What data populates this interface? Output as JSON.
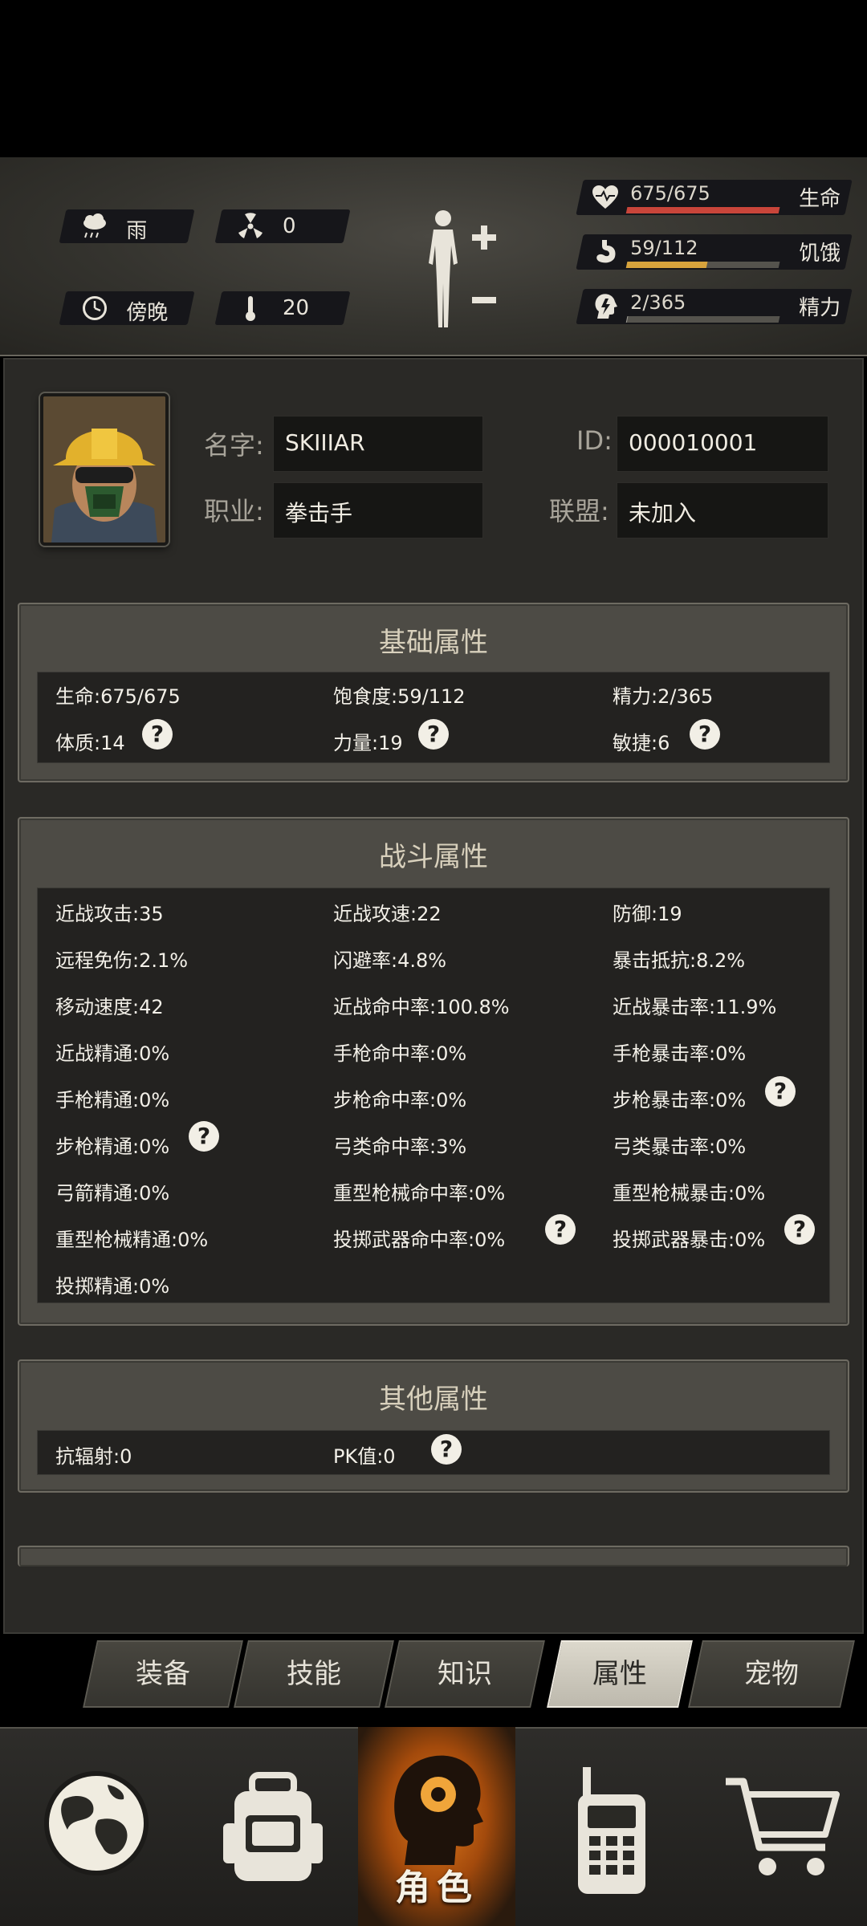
{
  "hud": {
    "weather": "雨",
    "radiation": "0",
    "time_of_day": "傍晚",
    "temperature": "20",
    "health": {
      "value": "675/675",
      "label": "生命",
      "fraction": 1.0,
      "color": "#c9453a"
    },
    "hunger": {
      "value": "59/112",
      "label": "饥饿",
      "fraction": 0.527,
      "color": "#d7a33c"
    },
    "energy": {
      "value": "2/365",
      "label": "精力",
      "fraction": 0.005,
      "color": "#9a9890"
    }
  },
  "profile": {
    "name_label": "名字:",
    "name": "SKIIIAR",
    "id_label": "ID:",
    "id": "000010001",
    "job_label": "职业:",
    "job": "拳击手",
    "alliance_label": "联盟:",
    "alliance": "未加入"
  },
  "basic": {
    "title": "基础属性",
    "items": [
      "生命:675/675",
      "饱食度:59/112",
      "精力:2/365",
      "体质:14",
      "力量:19",
      "敏捷:6"
    ]
  },
  "combat": {
    "title": "战斗属性",
    "items": [
      "近战攻击:35",
      "近战攻速:22",
      "防御:19",
      "远程免伤:2.1%",
      "闪避率:4.8%",
      "暴击抵抗:8.2%",
      "移动速度:42",
      "近战命中率:100.8%",
      "近战暴击率:11.9%",
      "近战精通:0%",
      "手枪命中率:0%",
      "手枪暴击率:0%",
      "手枪精通:0%",
      "步枪命中率:0%",
      "步枪暴击率:0%",
      "步枪精通:0%",
      "弓类命中率:3%",
      "弓类暴击率:0%",
      "弓箭精通:0%",
      "重型枪械命中率:0%",
      "重型枪械暴击:0%",
      "重型枪械精通:0%",
      "投掷武器命中率:0%",
      "投掷武器暴击:0%",
      "投掷精通:0%"
    ]
  },
  "other": {
    "title": "其他属性",
    "items": [
      "抗辐射:0",
      "PK值:0"
    ]
  },
  "help_glyph": "?",
  "tabs": [
    "装备",
    "技能",
    "知识",
    "属性",
    "宠物"
  ],
  "bottom_nav": {
    "role_label": "角色"
  }
}
